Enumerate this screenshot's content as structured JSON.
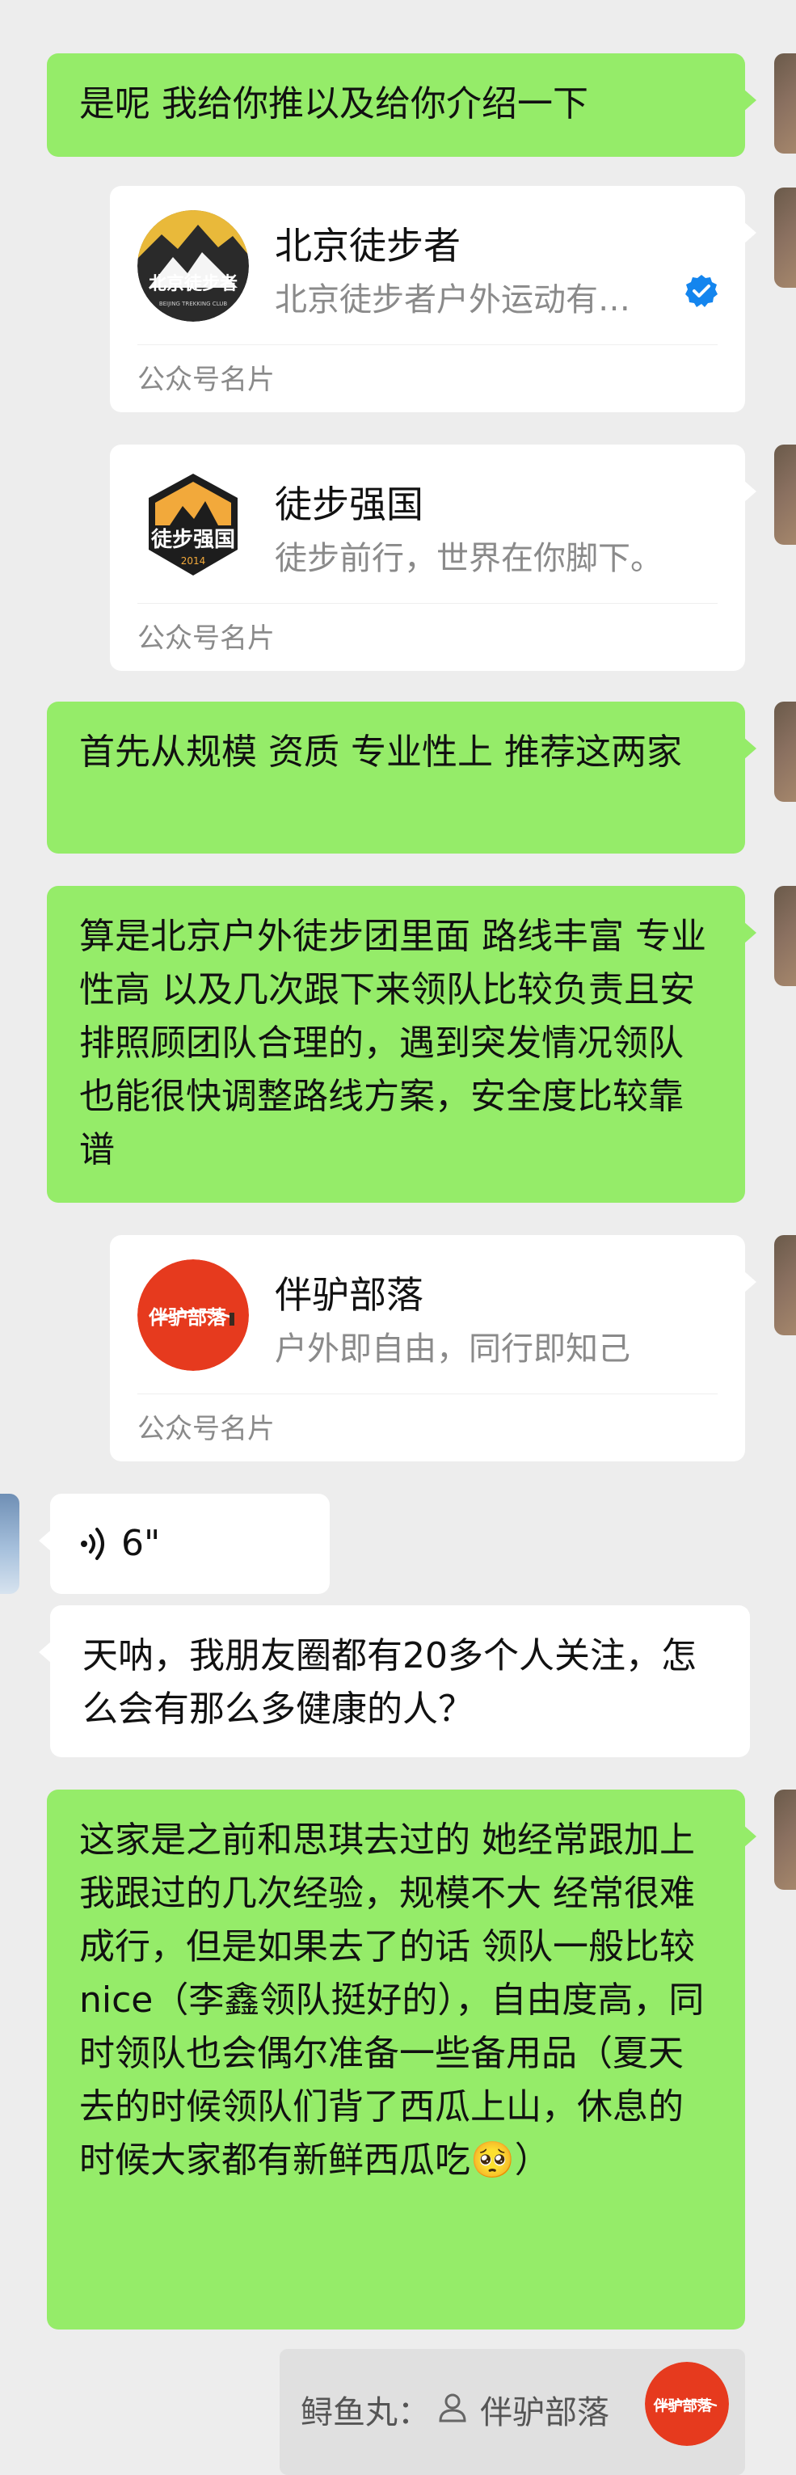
{
  "messages": {
    "m1": "是呢 我给你推以及给你介绍一下",
    "m2": "首先从规模 资质 专业性上 推荐这两家",
    "m3": "算是北京户外徒步团里面 路线丰富 专业性高 以及几次跟下来领队比较负责且安排照顾团队合理的，遇到突发情况领队也能很快调整路线方案，安全度比较靠谱",
    "m4": "天呐，我朋友圈都有20多个人关注，怎么会有那么多健康的人？",
    "m5_main": "这家是之前和思琪去过的 她经常跟加上我跟过的几次经验，规模不大 经常很难成行，但是如果去了的话 领队一般比较nice（李鑫领队挺好的），自由度高，同时领队也会偶尔准备一些备用品（夏天去的时候领队们背了西瓜上山，休息的时候大家都有新鲜西瓜吃",
    "m5_emoji": "🥺",
    "m5_close": "）"
  },
  "cards": [
    {
      "name": "北京徒步者",
      "desc": "北京徒步者户外运动有…",
      "type": "公众号名片",
      "verified": true,
      "logo_text": "北京徒步者"
    },
    {
      "name": "徒步强国",
      "desc": "徒步前行，世界在你脚下。",
      "type": "公众号名片",
      "verified": false,
      "logo_text": "徒步强国"
    },
    {
      "name": "伴驴部落",
      "desc": "户外即自由，同行即知己",
      "type": "公众号名片",
      "verified": false,
      "logo_text": "伴驴部落"
    }
  ],
  "voice": {
    "duration": "6\""
  },
  "quote": {
    "sender": "鲟鱼丸：",
    "title": "伴驴部落",
    "icon": "person-icon"
  },
  "colors": {
    "self_bubble": "#95ec69",
    "other_bubble": "#ffffff",
    "background": "#ededed",
    "verified": "#1485ee",
    "logo_red": "#e63a1e"
  }
}
